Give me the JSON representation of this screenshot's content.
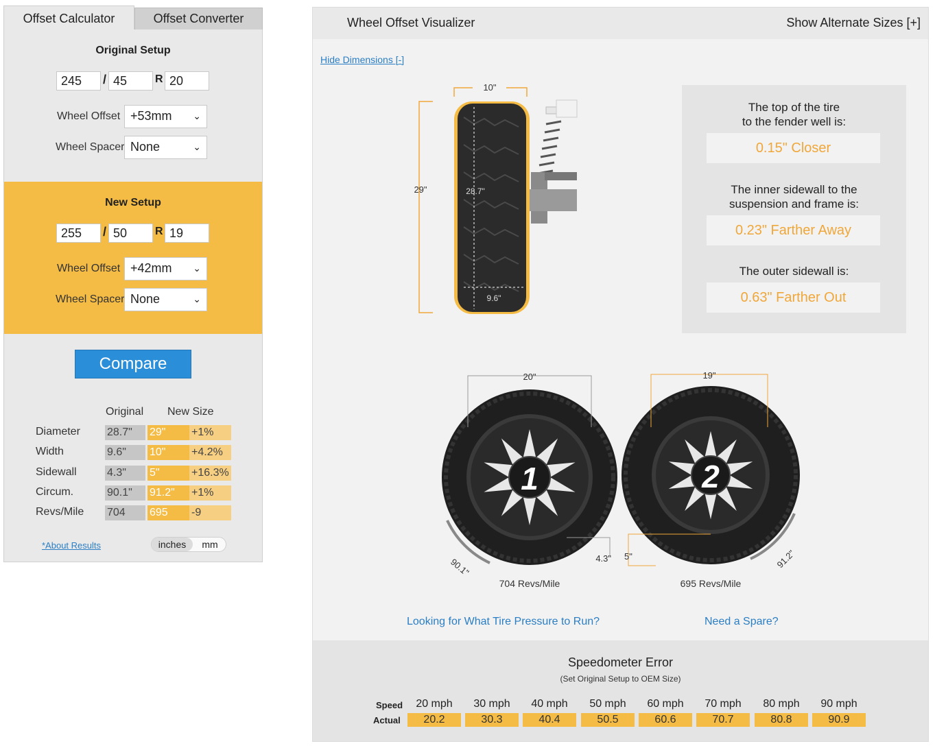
{
  "tabs": {
    "calculator": "Offset Calculator",
    "converter": "Offset Converter"
  },
  "original": {
    "title": "Original Setup",
    "width": "245",
    "aspect": "45",
    "rim": "20",
    "offset_label": "Wheel Offset",
    "offset": "+53mm",
    "spacer_label": "Wheel Spacer",
    "spacer": "None"
  },
  "new_setup": {
    "title": "New Setup",
    "width": "255",
    "aspect": "50",
    "rim": "19",
    "offset_label": "Wheel Offset",
    "offset": "+42mm",
    "spacer_label": "Wheel Spacer",
    "spacer": "None"
  },
  "separators": {
    "slash": "/",
    "r": "R"
  },
  "compare_label": "Compare",
  "results": {
    "col_original": "Original",
    "col_new": "New Size",
    "rows": [
      {
        "label": "Diameter",
        "original": "28.7\"",
        "new": "29\"",
        "diff": "+1%"
      },
      {
        "label": "Width",
        "original": "9.6\"",
        "new": "10\"",
        "diff": "+4.2%"
      },
      {
        "label": "Sidewall",
        "original": "4.3\"",
        "new": "5\"",
        "diff": "+16.3%"
      },
      {
        "label": "Circum.",
        "original": "90.1\"",
        "new": "91.2\"",
        "diff": "+1%"
      },
      {
        "label": "Revs/Mile",
        "original": "704",
        "new": "695",
        "diff": "-9"
      }
    ]
  },
  "about_link": "*About Results",
  "units": {
    "inches": "inches",
    "mm": "mm"
  },
  "visualizer": {
    "title": "Wheel Offset Visualizer",
    "alt_sizes": "Show Alternate Sizes [+]",
    "hide_dims": "Hide Dimensions [-]",
    "side_dims": {
      "width": "10\"",
      "height": "29\"",
      "inner_height": "28.7\"",
      "inner_width": "9.6\""
    },
    "comparisons": [
      {
        "text1": "The top of the tire",
        "text2": "to the fender well is:",
        "value": "0.15\" Closer"
      },
      {
        "text1": "The inner sidewall to the",
        "text2": "suspension and frame is:",
        "value": "0.23\" Farther Away"
      },
      {
        "text1": "The outer sidewall is:",
        "text2": "",
        "value": "0.63\" Farther Out"
      }
    ],
    "wheel1": {
      "rim": "20\"",
      "sidewall": "4.3\"",
      "circum": "90.1\"",
      "revs": "704 Revs/Mile",
      "number": "1"
    },
    "wheel2": {
      "rim": "19\"",
      "sidewall": "5\"",
      "circum": "91.2\"",
      "revs": "695 Revs/Mile",
      "number": "2"
    }
  },
  "links": {
    "pressure": "Looking for What Tire Pressure to Run?",
    "spare": "Need a Spare?"
  },
  "speedometer": {
    "title": "Speedometer Error",
    "subtitle": "(Set Original Setup to OEM Size)",
    "speed_label": "Speed",
    "actual_label": "Actual",
    "speeds": [
      "20 mph",
      "30 mph",
      "40 mph",
      "50 mph",
      "60 mph",
      "70 mph",
      "80 mph",
      "90 mph"
    ],
    "actuals": [
      "20.2",
      "30.3",
      "40.4",
      "50.5",
      "60.6",
      "70.7",
      "80.8",
      "90.9"
    ]
  },
  "colors": {
    "accent": "#f4bb45",
    "button": "#2a8ed8",
    "link": "#2a7ec4",
    "value_text": "#f0a73a"
  }
}
